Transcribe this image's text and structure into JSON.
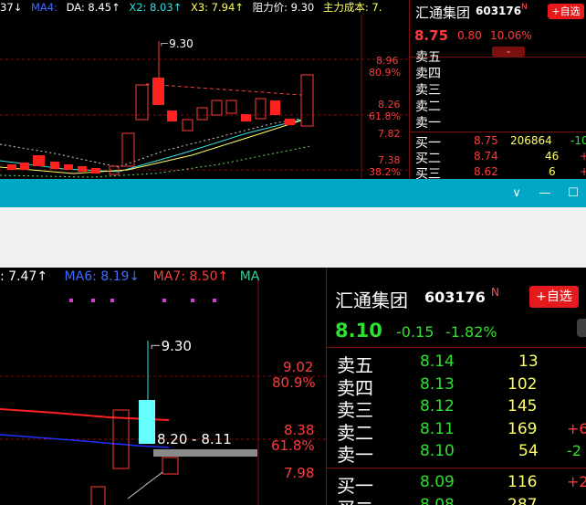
{
  "top": {
    "indicator_bar": [
      {
        "text": "37↓",
        "color": "#ffffff"
      },
      {
        "text": "MA4:",
        "color": "#3f6bff"
      },
      {
        "text": "DA: 8.45↑",
        "color": "#ffffff"
      },
      {
        "text": "X2: 8.03↑",
        "color": "#36e0e0"
      },
      {
        "text": "X3: 7.94↑",
        "color": "#ffff66"
      },
      {
        "text": "阻力价: 9.30",
        "color": "#ffffff"
      },
      {
        "text": "主力成本: 7.",
        "color": "#ffff66"
      }
    ],
    "high_label": "9.30",
    "price_axis": [
      "8.96",
      "80.9%",
      "8.26",
      "61.8%",
      "7.82",
      "7.38",
      "38.2%"
    ],
    "stock": {
      "name": "汇通集团",
      "code": "603176",
      "badge": "N",
      "add_button": "+自选",
      "price": "8.75",
      "change": "0.80",
      "pct": "10.06%"
    },
    "asks": [
      "卖五",
      "卖四",
      "卖三",
      "卖二",
      "卖一"
    ],
    "bids": [
      {
        "label": "买一",
        "price": "8.75",
        "vol": "206864",
        "chg": "-10"
      },
      {
        "label": "买二",
        "price": "8.74",
        "vol": "46",
        "chg": "+"
      },
      {
        "label": "买三",
        "price": "8.62",
        "vol": "6",
        "chg": "+"
      }
    ]
  },
  "window": {
    "minimize_icon": "—",
    "maximize_icon": "☐",
    "dropdown_icon": "∨"
  },
  "bottom": {
    "indicator_bar": [
      {
        "text": ": 7.47↑",
        "color": "#ffffff"
      },
      {
        "text": "MA6: 8.19↓",
        "color": "#3f6bff"
      },
      {
        "text": "MA7: 8.50↑",
        "color": "#ff3b3b"
      },
      {
        "text": "MA",
        "color": "#30d0a0"
      }
    ],
    "high_label": "9.30",
    "resistance_label": "8.20 - 8.11",
    "price_axis": [
      "9.02",
      "80.9%",
      "8.38",
      "61.8%",
      "7.98"
    ],
    "stock": {
      "name": "汇通集团",
      "code": "603176",
      "badge": "N",
      "add_button": "+自选",
      "price": "8.10",
      "change": "-0.15",
      "pct": "-1.82%"
    },
    "asks": [
      {
        "label": "卖五",
        "price": "8.14",
        "vol": "13",
        "chg": ""
      },
      {
        "label": "卖四",
        "price": "8.13",
        "vol": "102",
        "chg": ""
      },
      {
        "label": "卖三",
        "price": "8.12",
        "vol": "145",
        "chg": ""
      },
      {
        "label": "卖二",
        "price": "8.11",
        "vol": "169",
        "chg": "+6"
      },
      {
        "label": "卖一",
        "price": "8.10",
        "vol": "54",
        "chg": "-2"
      }
    ],
    "bids": [
      {
        "label": "买一",
        "price": "8.09",
        "vol": "116",
        "chg": "+2"
      },
      {
        "label": "买二",
        "price": "8.08",
        "vol": "287",
        "chg": ""
      }
    ]
  }
}
